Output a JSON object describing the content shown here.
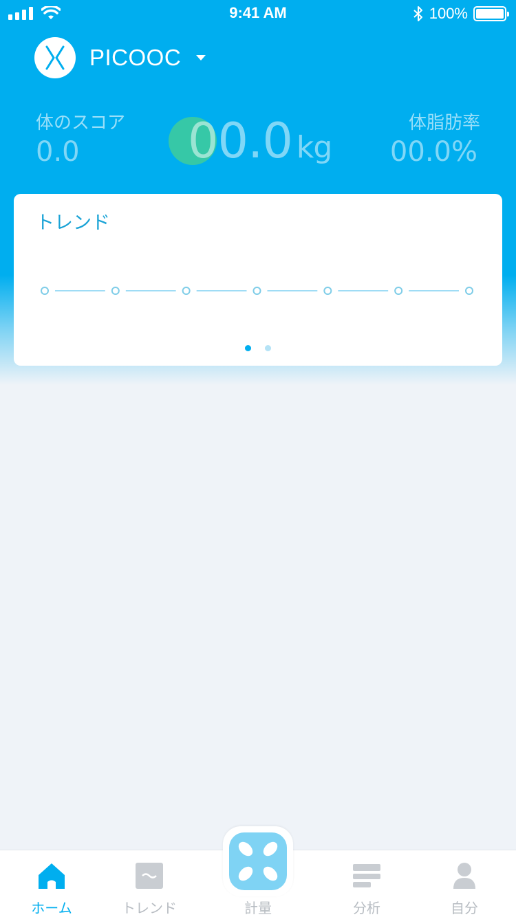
{
  "status_bar": {
    "time": "9:41 AM",
    "battery_percent": "100%",
    "bluetooth_icon": "bluetooth-icon"
  },
  "header": {
    "brand_name": "PICOOC",
    "logo_icon": "picooc-logo-icon"
  },
  "stats": {
    "body_score_label": "体のスコア",
    "body_score_value": "0.0",
    "weight_value": "00.0",
    "weight_unit": "kg",
    "body_fat_label": "体脂肪率",
    "body_fat_value": "00.0%"
  },
  "trend_card": {
    "title": "トレンド",
    "point_count": 7,
    "pages": 2,
    "active_page": 0
  },
  "tab_bar": {
    "tabs": [
      {
        "label": "ホーム",
        "icon": "home-icon",
        "active": true
      },
      {
        "label": "トレンド",
        "icon": "trend-icon",
        "active": false
      },
      {
        "label": "計量",
        "icon": "scale-icon",
        "active": false
      },
      {
        "label": "分析",
        "icon": "analysis-icon",
        "active": false
      },
      {
        "label": "自分",
        "icon": "profile-icon",
        "active": false
      }
    ]
  },
  "colors": {
    "brand_blue": "#00aeef",
    "accent_green": "#3ccb9e",
    "inactive_gray": "#b7bcc2"
  }
}
